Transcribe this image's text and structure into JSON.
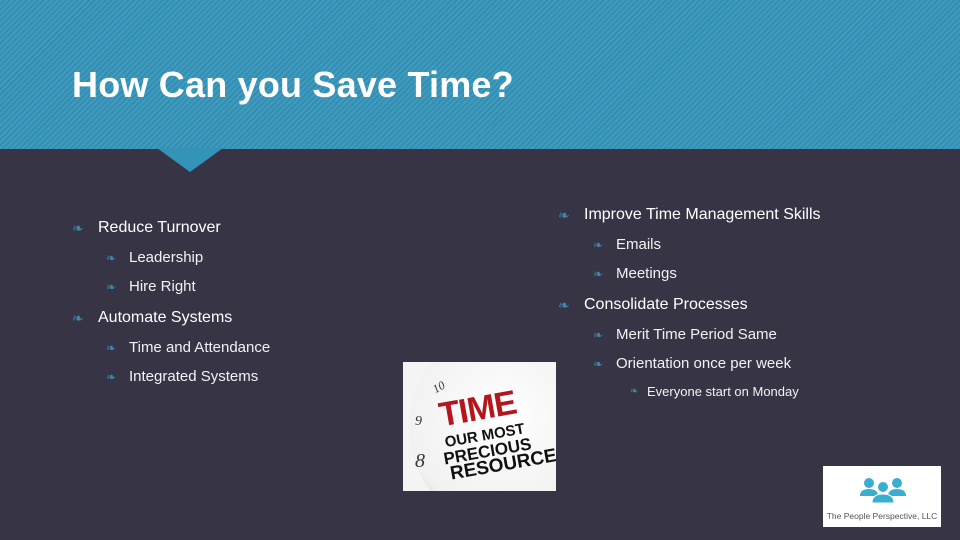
{
  "slide": {
    "title": "How Can you Save Time?",
    "colors": {
      "header": "#3393b8",
      "background": "#373545",
      "bullet": "#3f86ad",
      "text": "#ffffff",
      "logo_icon": "#3aaed0"
    }
  },
  "left_column": [
    {
      "label": "Reduce Turnover",
      "icon": "fleuron-bullet-icon",
      "children": [
        {
          "label": "Leadership"
        },
        {
          "label": "Hire Right"
        }
      ]
    },
    {
      "label": "Automate Systems",
      "icon": "fleuron-bullet-icon",
      "children": [
        {
          "label": "Time and Attendance"
        },
        {
          "label": "Integrated Systems"
        }
      ]
    }
  ],
  "right_column": [
    {
      "label": "Improve Time Management Skills",
      "icon": "fleuron-bullet-icon",
      "children": [
        {
          "label": "Emails"
        },
        {
          "label": "Meetings"
        }
      ]
    },
    {
      "label": "Consolidate Processes",
      "icon": "fleuron-bullet-icon",
      "children": [
        {
          "label": "Merit Time Period Same"
        },
        {
          "label": "Orientation once per week",
          "children": [
            {
              "label": "Everyone start on Monday"
            }
          ]
        }
      ]
    }
  ],
  "image": {
    "line1": "TIME",
    "line2": "OUR MOST",
    "line3": "PRECIOUS",
    "line4": "RESOURCE",
    "clock_numbers": [
      "10",
      "9",
      "8"
    ]
  },
  "logo": {
    "caption": "The People Perspective, LLC"
  },
  "bullet_glyph": "❧"
}
